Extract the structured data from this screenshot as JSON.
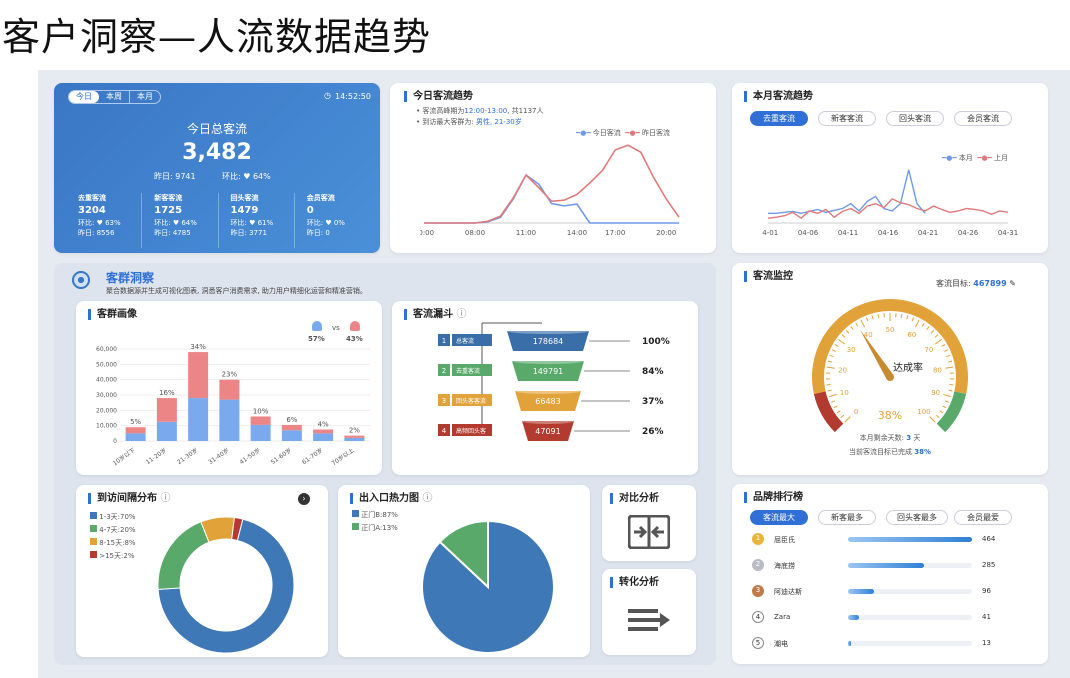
{
  "slide_title": "客户洞察—人流数据趋势",
  "today_card": {
    "tabs": [
      "今日",
      "本周",
      "本月"
    ],
    "time": "14:52:50",
    "label": "今日总客流",
    "value": "3,482",
    "yesterday": "昨日: 9741",
    "ratio": "环比: ♥ 64%",
    "stats": [
      {
        "label": "去重客流",
        "value": "3204",
        "ratio": "环比: ♥ 63%",
        "yday": "昨日: 8556"
      },
      {
        "label": "新客客流",
        "value": "1725",
        "ratio": "环比: ♥ 64%",
        "yday": "昨日: 4785"
      },
      {
        "label": "回头客流",
        "value": "1479",
        "ratio": "环比: ♥ 61%",
        "yday": "昨日: 3771"
      },
      {
        "label": "会员客流",
        "value": "0",
        "ratio": "环比: ♥ 0%",
        "yday": "昨日: 0"
      }
    ]
  },
  "today_trend": {
    "title": "今日客流趋势",
    "note1_prefix": "客流高峰期为",
    "note1_time": "12:00-13:00",
    "note1_suffix": ", 共1137人",
    "note2_prefix": "到访最大客群为: ",
    "note2_value": "男性, 21-30岁",
    "legend": [
      "今日客流",
      "昨日客流"
    ]
  },
  "month_trend": {
    "title": "本月客流趋势",
    "tabs": [
      "去重客流",
      "新客客流",
      "回头客流",
      "会员客流"
    ],
    "legend": [
      "本月",
      "上月"
    ]
  },
  "insight": {
    "title": "客群洞察",
    "desc": "聚合数据源并生成可视化图表, 洞悉客户消费需求, 助力用户精细化运营和精准营销。"
  },
  "portrait": {
    "title": "客群画像",
    "male": "57%",
    "female": "43%",
    "vs": "vs"
  },
  "funnel": {
    "title": "客流漏斗",
    "steps": [
      {
        "n": "1",
        "label": "总客流",
        "value": "178684",
        "pct": "100%"
      },
      {
        "n": "2",
        "label": "去重客流",
        "value": "149791",
        "pct": "84%"
      },
      {
        "n": "3",
        "label": "回头客客流",
        "value": "66483",
        "pct": "37%"
      },
      {
        "n": "4",
        "label": "高频回头客",
        "value": "47091",
        "pct": "26%"
      }
    ]
  },
  "monitor": {
    "title": "客流监控",
    "target_label": "客流目标:",
    "target": "467899",
    "gauge_label": "达成率",
    "gauge_value": "38%",
    "ticks": [
      "0",
      "10",
      "20",
      "30",
      "40",
      "50",
      "60",
      "70",
      "80",
      "90",
      "100"
    ],
    "remain_label": "本月剩余天数:",
    "remain_days": "3",
    "remain_unit": "天",
    "done_label": "当前客流目标已完成",
    "done_value": "38%"
  },
  "interval": {
    "title": "到访间隔分布",
    "legend": [
      {
        "label": "1-3天:70%",
        "color": "#3f78b7"
      },
      {
        "label": "4-7天:20%",
        "color": "#59a96a"
      },
      {
        "label": "8-15天:8%",
        "color": "#e2a23a"
      },
      {
        "label": ">15天:2%",
        "color": "#b33a2e"
      }
    ]
  },
  "heatmap": {
    "title": "出入口热力图",
    "legend": [
      {
        "label": "正门B:87%",
        "color": "#3f78b7"
      },
      {
        "label": "正门A:13%",
        "color": "#59a96a"
      }
    ]
  },
  "compare": {
    "title": "对比分析"
  },
  "convert": {
    "title": "转化分析"
  },
  "brand": {
    "title": "品牌排行榜",
    "tabs": [
      "客流最大",
      "新客最多",
      "回头客最多",
      "会员最爱"
    ],
    "items": [
      {
        "rank": "1",
        "name": "屈臣氏",
        "value": "464"
      },
      {
        "rank": "2",
        "name": "海底捞",
        "value": "285"
      },
      {
        "rank": "3",
        "name": "阿迪达斯",
        "value": "96"
      },
      {
        "rank": "4",
        "name": "Zara",
        "value": "41"
      },
      {
        "rank": "5",
        "name": "潮电",
        "value": "13"
      }
    ]
  },
  "chart_data": [
    {
      "type": "line",
      "title": "今日客流趋势",
      "x": [
        "00:00",
        "02:00",
        "04:00",
        "06:00",
        "08:00",
        "09:00",
        "10:00",
        "10:30",
        "11:00",
        "11:30",
        "12:00",
        "13:00",
        "14:00",
        "15:00",
        "16:00",
        "17:00",
        "17:30",
        "18:00",
        "19:00",
        "20:00",
        "21:00"
      ],
      "x_ticks": [
        "00:00",
        "08:00",
        "11:00",
        "14:00",
        "17:00",
        "20:00"
      ],
      "series": [
        {
          "name": "今日客流",
          "color": "#6f9ae6",
          "values": [
            0,
            0,
            0,
            0,
            0,
            10,
            50,
            210,
            420,
            340,
            170,
            150,
            165,
            0,
            0,
            0,
            0,
            0,
            0,
            0,
            0
          ]
        },
        {
          "name": "昨日客流",
          "color": "#e07a7a",
          "values": [
            0,
            0,
            0,
            0,
            0,
            15,
            60,
            220,
            420,
            310,
            190,
            200,
            250,
            350,
            460,
            640,
            680,
            620,
            400,
            210,
            50
          ]
        }
      ]
    },
    {
      "type": "line",
      "title": "本月客流趋势",
      "x_ticks": [
        "04-01",
        "04-06",
        "04-11",
        "04-16",
        "04-21",
        "04-26",
        "04-31"
      ],
      "series": [
        {
          "name": "本月",
          "color": "#6f9ae6",
          "values": [
            20,
            20,
            22,
            24,
            20,
            24,
            28,
            22,
            26,
            30,
            40,
            25,
            45,
            55,
            30,
            25,
            40,
            110,
            40,
            20
          ]
        },
        {
          "name": "上月",
          "color": "#e07a7a",
          "values": [
            10,
            12,
            15,
            22,
            10,
            25,
            20,
            28,
            12,
            24,
            30,
            20,
            35,
            40,
            32,
            50,
            42,
            38,
            30,
            25,
            35,
            28,
            22,
            25,
            30,
            28,
            25,
            18,
            25,
            22
          ]
        }
      ]
    },
    {
      "type": "bar",
      "title": "客群画像",
      "categories": [
        "10岁以下",
        "11-20岁",
        "21-30岁",
        "31-40岁",
        "41-50岁",
        "51-60岁",
        "61-70岁",
        "70岁以上"
      ],
      "labels": [
        "5%",
        "16%",
        "34%",
        "23%",
        "10%",
        "6%",
        "4%",
        "2%"
      ],
      "series": [
        {
          "name": "男",
          "color": "#7aa9ee",
          "values": [
            5000,
            12500,
            28000,
            27000,
            10500,
            7000,
            5000,
            2000
          ]
        },
        {
          "name": "女",
          "color": "#ec8686",
          "values": [
            4000,
            15500,
            30000,
            13000,
            5500,
            3500,
            2500,
            1500
          ]
        }
      ],
      "ylim": [
        0,
        60000
      ],
      "y_ticks": [
        "0",
        "10,000",
        "20,000",
        "30,000",
        "40,000",
        "50,000",
        "60,000"
      ]
    },
    {
      "type": "pie",
      "title": "到访间隔分布",
      "values": [
        70,
        20,
        8,
        2
      ],
      "labels": [
        "1-3天",
        "4-7天",
        "8-15天",
        ">15天"
      ]
    },
    {
      "type": "pie",
      "title": "出入口热力图",
      "values": [
        87,
        13
      ],
      "labels": [
        "正门B",
        "正门A"
      ]
    },
    {
      "type": "bar",
      "title": "品牌排行榜",
      "categories": [
        "屈臣氏",
        "海底捞",
        "阿迪达斯",
        "Zara",
        "潮电"
      ],
      "values": [
        464,
        285,
        96,
        41,
        13
      ]
    }
  ]
}
